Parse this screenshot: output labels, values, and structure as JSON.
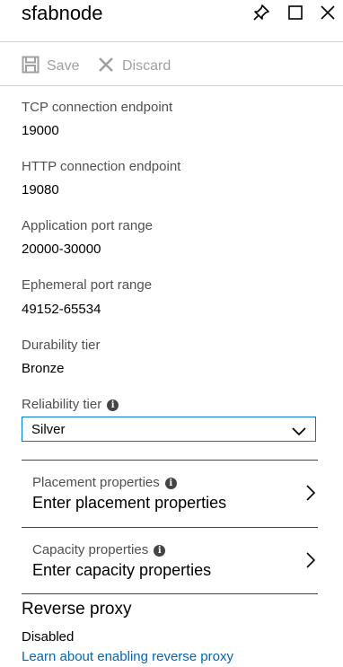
{
  "header": {
    "title": "sfabnode",
    "pin_icon": "pin-icon",
    "maximize_icon": "maximize-icon",
    "close_icon": "close-icon"
  },
  "toolbar": {
    "save_label": "Save",
    "discard_label": "Discard",
    "save_icon": "save-icon",
    "discard_icon": "discard-icon"
  },
  "fields": {
    "tcp_label": "TCP connection endpoint",
    "tcp_value": "19000",
    "http_label": "HTTP connection endpoint",
    "http_value": "19080",
    "app_port_label": "Application port range",
    "app_port_value": "20000-30000",
    "ephemeral_label": "Ephemeral port range",
    "ephemeral_value": "49152-65534",
    "durability_label": "Durability tier",
    "durability_value": "Bronze",
    "reliability_label": "Reliability tier",
    "reliability_value": "Silver"
  },
  "placement": {
    "label": "Placement properties",
    "value": "Enter placement properties"
  },
  "capacity": {
    "label": "Capacity properties",
    "value": "Enter capacity properties"
  },
  "reverse_proxy": {
    "title": "Reverse proxy",
    "status": "Disabled",
    "link": "Learn about enabling reverse proxy"
  },
  "colors": {
    "accent": "#0078d4",
    "link": "#0067b8",
    "disabled_text": "#a0a0a0"
  }
}
